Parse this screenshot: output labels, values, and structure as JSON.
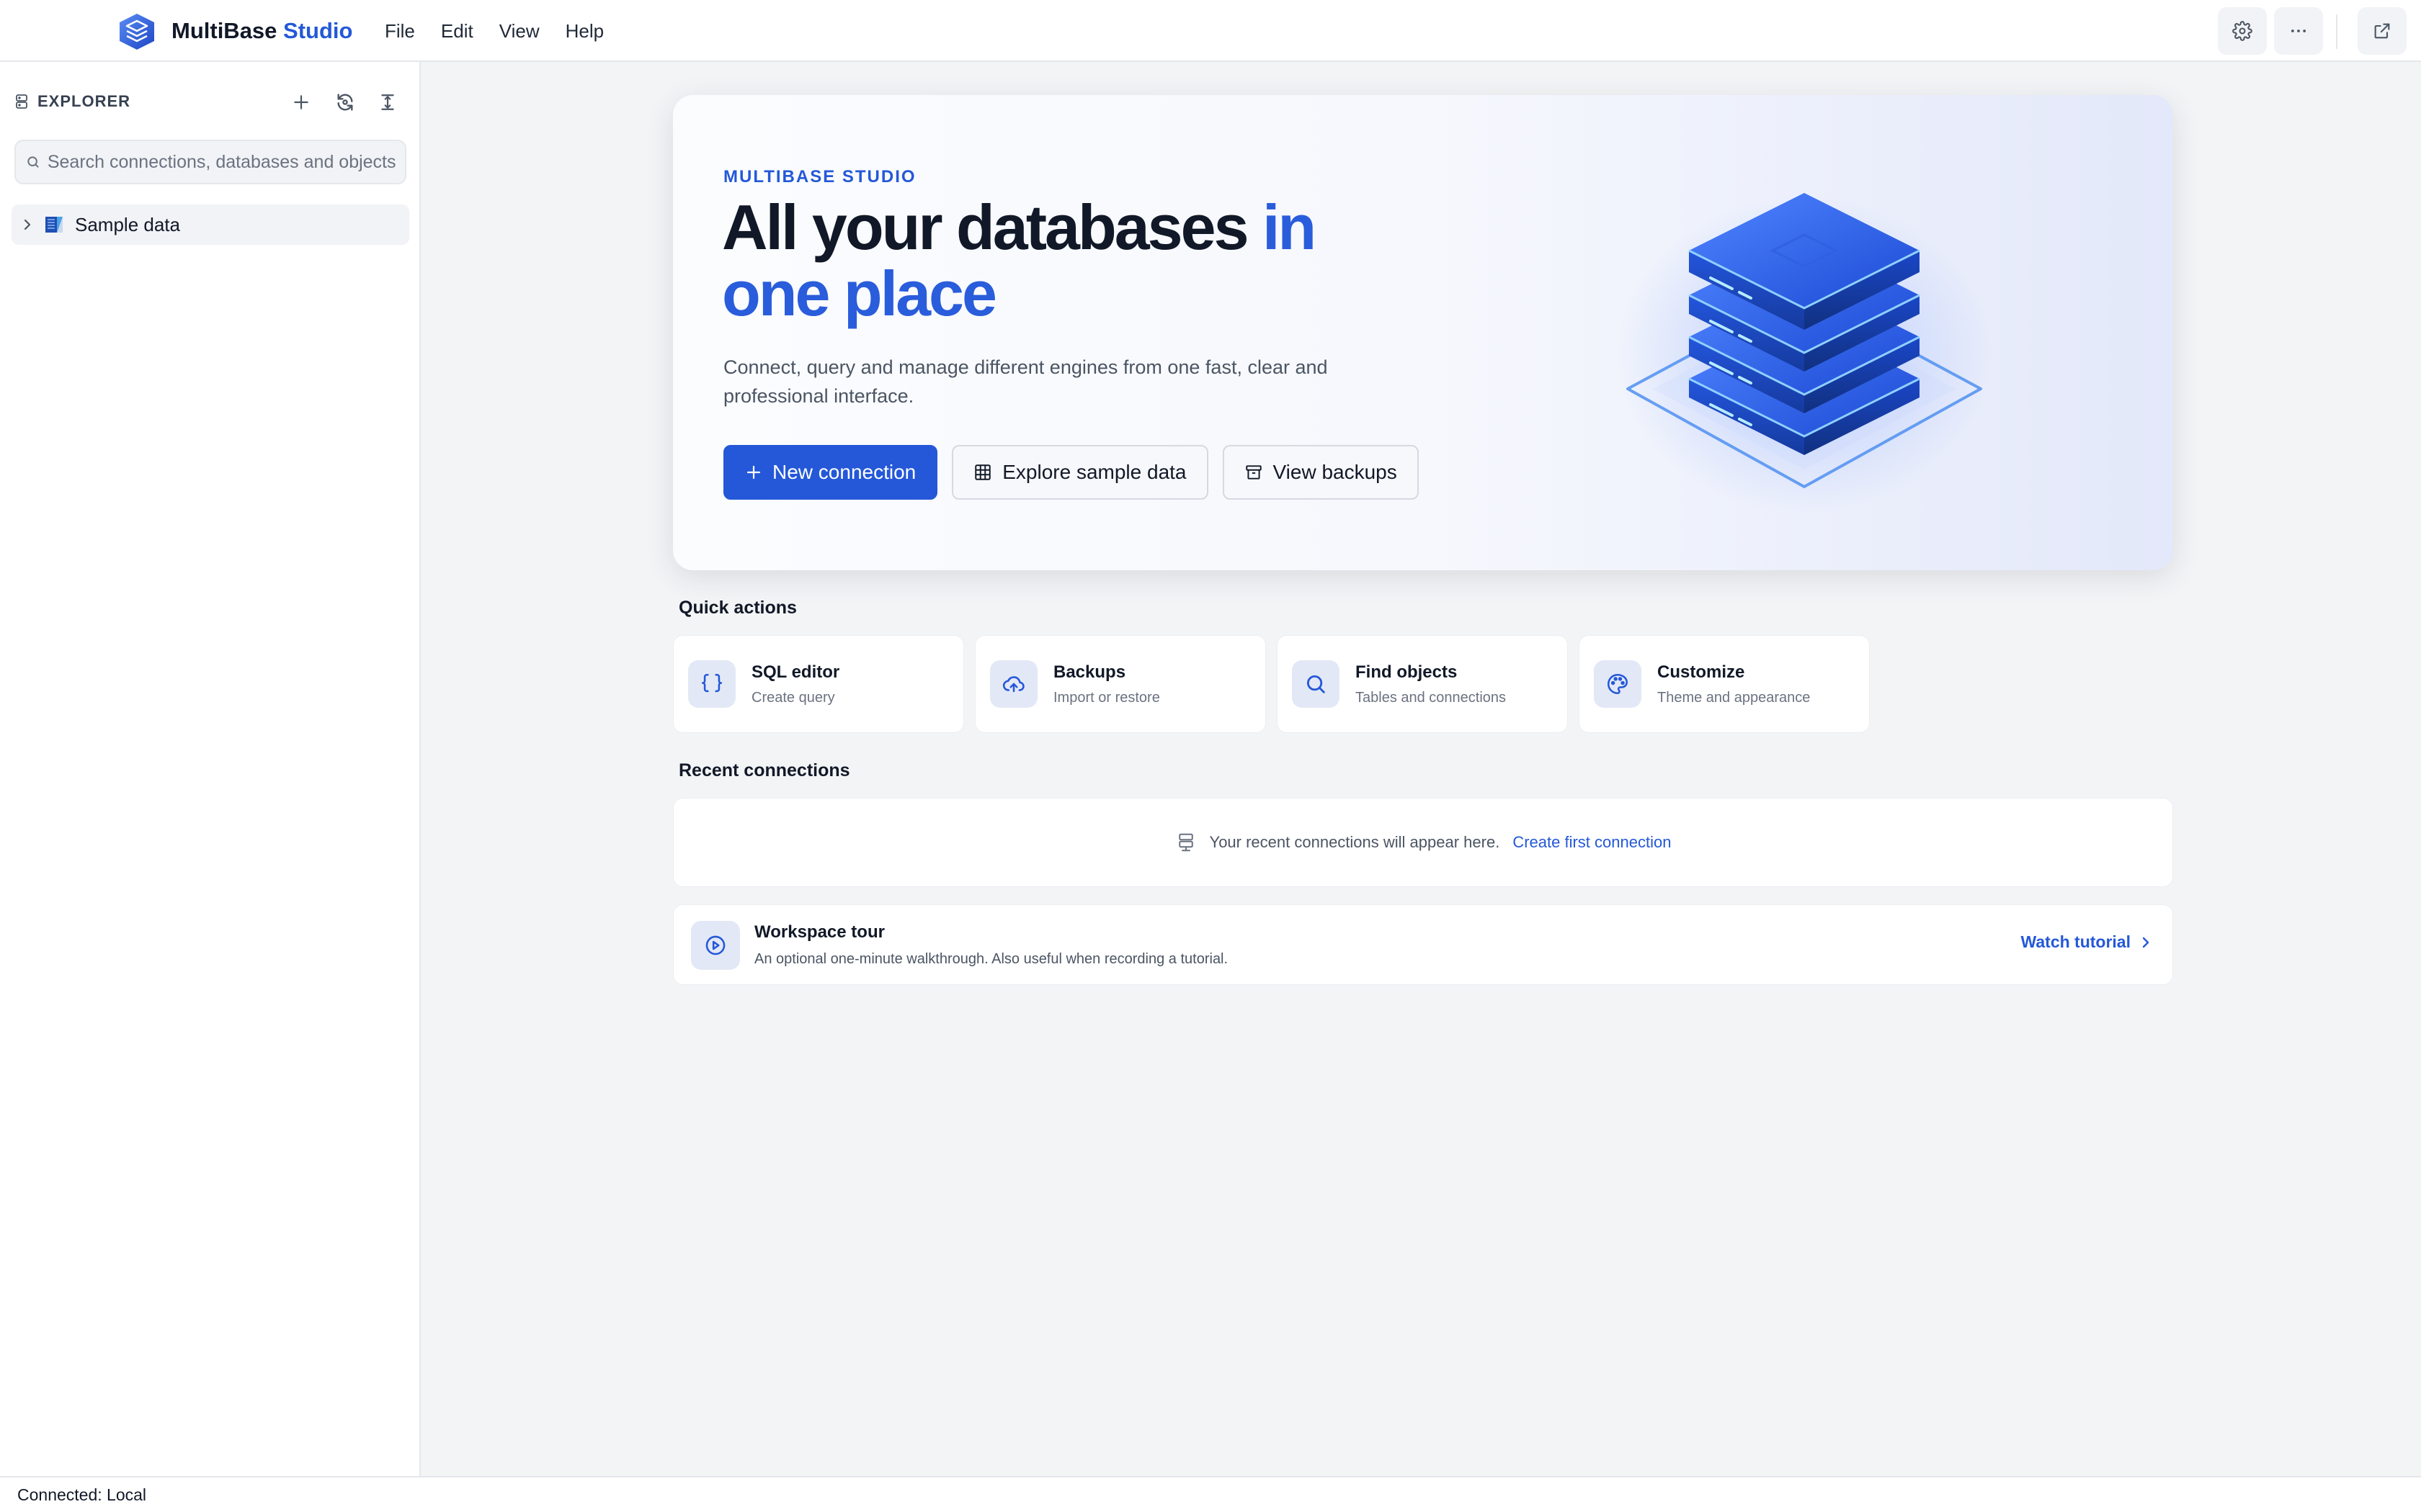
{
  "app": {
    "brand_main": "MultiBase",
    "brand_accent": "Studio",
    "colors": {
      "accent": "#2458d8",
      "background": "#f3f4f6"
    }
  },
  "menu": [
    "File",
    "Edit",
    "View",
    "Help"
  ],
  "toolbar": {
    "icons": [
      "gear-icon",
      "more-icon",
      "external-window-icon"
    ]
  },
  "sidebar": {
    "title": "EXPLORER",
    "search_placeholder": "Search connections, databases and objects",
    "items": [
      {
        "label": "Sample data",
        "icon": "database-icon"
      }
    ]
  },
  "hero": {
    "eyebrow": "MULTIBASE STUDIO",
    "title_main": "All your databases",
    "title_accent": "in one place",
    "description": "Connect, query and manage different engines from one fast, clear and professional interface.",
    "actions": {
      "new_connection": "New connection",
      "explore_sample": "Explore sample data",
      "view_backups": "View backups"
    }
  },
  "quick_actions": {
    "title": "Quick actions",
    "items": [
      {
        "title": "SQL editor",
        "subtitle": "Create query",
        "icon": "braces-icon"
      },
      {
        "title": "Backups",
        "subtitle": "Import or restore",
        "icon": "cloud-upload-icon"
      },
      {
        "title": "Find objects",
        "subtitle": "Tables and connections",
        "icon": "search-icon"
      },
      {
        "title": "Customize",
        "subtitle": "Theme and appearance",
        "icon": "palette-icon"
      }
    ]
  },
  "recent": {
    "title": "Recent connections",
    "empty_text": "Your recent connections will appear here.",
    "link": "Create first connection"
  },
  "tour": {
    "title": "Workspace tour",
    "subtitle": "An optional one-minute walkthrough. Also useful when recording a tutorial.",
    "link": "Watch tutorial"
  },
  "status": {
    "text": "Connected: Local"
  }
}
